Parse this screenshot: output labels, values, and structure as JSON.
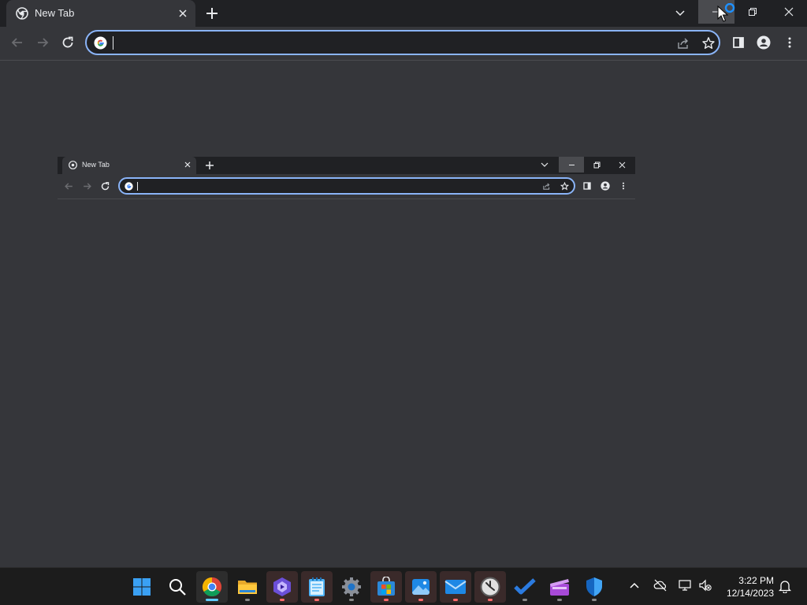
{
  "browser": {
    "tab_title": "New Tab",
    "omnibox_value": "",
    "omnibox_placeholder": ""
  },
  "mini_browser": {
    "tab_title": "New Tab"
  },
  "taskbar": {
    "apps": [
      "start",
      "search",
      "chrome",
      "file-explorer",
      "clipchamp",
      "notepad",
      "settings",
      "microsoft-store",
      "photos",
      "mail",
      "clock",
      "to-do",
      "clipchamp-video",
      "windows-security"
    ],
    "time": "3:22 PM",
    "date": "12/14/2023"
  },
  "colors": {
    "background": "#35363a",
    "titlebar": "#202124",
    "accent": "#8ab4f8",
    "taskbar": "#1c1c1c"
  }
}
